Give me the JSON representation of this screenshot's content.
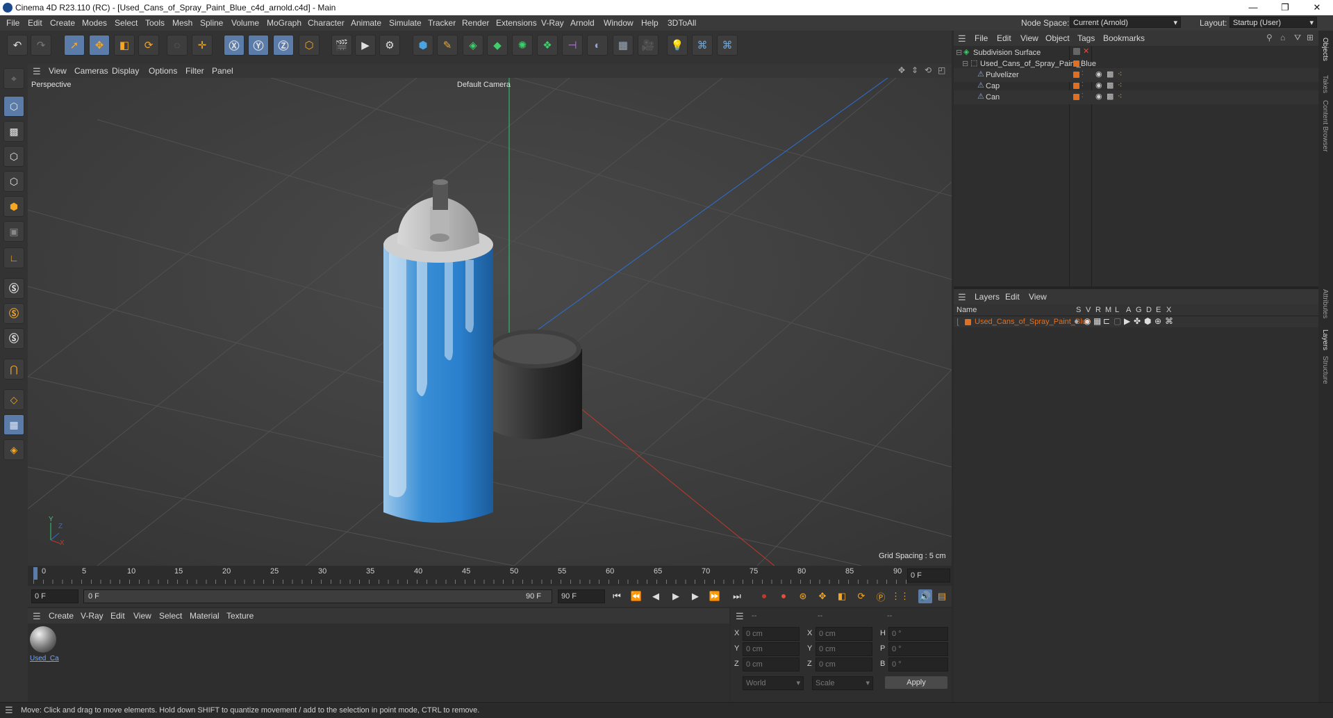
{
  "window": {
    "title": "Cinema 4D R23.110 (RC) - [Used_Cans_of_Spray_Paint_Blue_c4d_arnold.c4d] - Main",
    "minimize": "—",
    "maximize": "❐",
    "close": "✕"
  },
  "menubar": {
    "items": [
      "File",
      "Edit",
      "Create",
      "Modes",
      "Select",
      "Tools",
      "Mesh",
      "Spline",
      "Volume",
      "MoGraph",
      "Character",
      "Animate",
      "Simulate",
      "Tracker",
      "Render",
      "Extensions",
      "V-Ray",
      "Arnold",
      "Window",
      "Help",
      "3DToAll"
    ],
    "node_space_label": "Node Space:",
    "node_space_value": "Current (Arnold)",
    "layout_label": "Layout:",
    "layout_value": "Startup (User)"
  },
  "viewport": {
    "menu": [
      "View",
      "Cameras",
      "Display",
      "Options",
      "Filter",
      "Panel"
    ],
    "label": "Perspective",
    "camera": "Default Camera",
    "grid_spacing": "Grid Spacing : 5 cm",
    "axis_y": "Y",
    "axis_z": "Z",
    "axis_x": "X"
  },
  "timeline": {
    "ticks": [
      "0",
      "5",
      "10",
      "15",
      "20",
      "25",
      "30",
      "35",
      "40",
      "45",
      "50",
      "55",
      "60",
      "65",
      "70",
      "75",
      "80",
      "85",
      "90"
    ],
    "current_frame_right": "0 F"
  },
  "transport": {
    "start_frame": "0 F",
    "range_start": "0 F",
    "range_end": "90 F",
    "end_frame": "90 F"
  },
  "material_manager": {
    "menu": [
      "Create",
      "V-Ray",
      "Edit",
      "View",
      "Select",
      "Material",
      "Texture"
    ],
    "material_name": "Used_Ca"
  },
  "coordinates": {
    "header": [
      "--",
      "--",
      "--"
    ],
    "rows": [
      {
        "a": "X",
        "av": "0 cm",
        "b": "X",
        "bv": "0 cm",
        "c": "H",
        "cv": "0 °"
      },
      {
        "a": "Y",
        "av": "0 cm",
        "b": "Y",
        "bv": "0 cm",
        "c": "P",
        "cv": "0 °"
      },
      {
        "a": "Z",
        "av": "0 cm",
        "b": "Z",
        "bv": "0 cm",
        "c": "B",
        "cv": "0 °"
      }
    ],
    "world": "World",
    "scale": "Scale",
    "apply": "Apply"
  },
  "status": "Move: Click and drag to move elements. Hold down SHIFT to quantize movement / add to the selection in point mode, CTRL to remove.",
  "object_manager": {
    "menu": [
      "File",
      "Edit",
      "View",
      "Object",
      "Tags",
      "Bookmarks"
    ],
    "objects": [
      {
        "name": "Subdivision Surface"
      },
      {
        "name": "Used_Cans_of_Spray_Paint_Blue"
      },
      {
        "name": "Pulvelizer"
      },
      {
        "name": "Cap"
      },
      {
        "name": "Can"
      }
    ]
  },
  "layer_manager": {
    "menu": [
      "Layers",
      "Edit",
      "View"
    ],
    "name_header": "Name",
    "columns": [
      "S",
      "V",
      "R",
      "M",
      "L",
      "A",
      "G",
      "D",
      "E",
      "X"
    ],
    "layer_name": "Used_Cans_of_Spray_Paint_Blue"
  },
  "right_tabs": [
    "Objects",
    "Takes",
    "Content Browser",
    "Attributes",
    "Layers",
    "Structure"
  ],
  "colors": {
    "accent": "#5b7ca8",
    "layer_orange": "#e07020",
    "x_axis": "#c0392b",
    "y_axis": "#2ecc71",
    "z_axis": "#2e6fd1"
  }
}
